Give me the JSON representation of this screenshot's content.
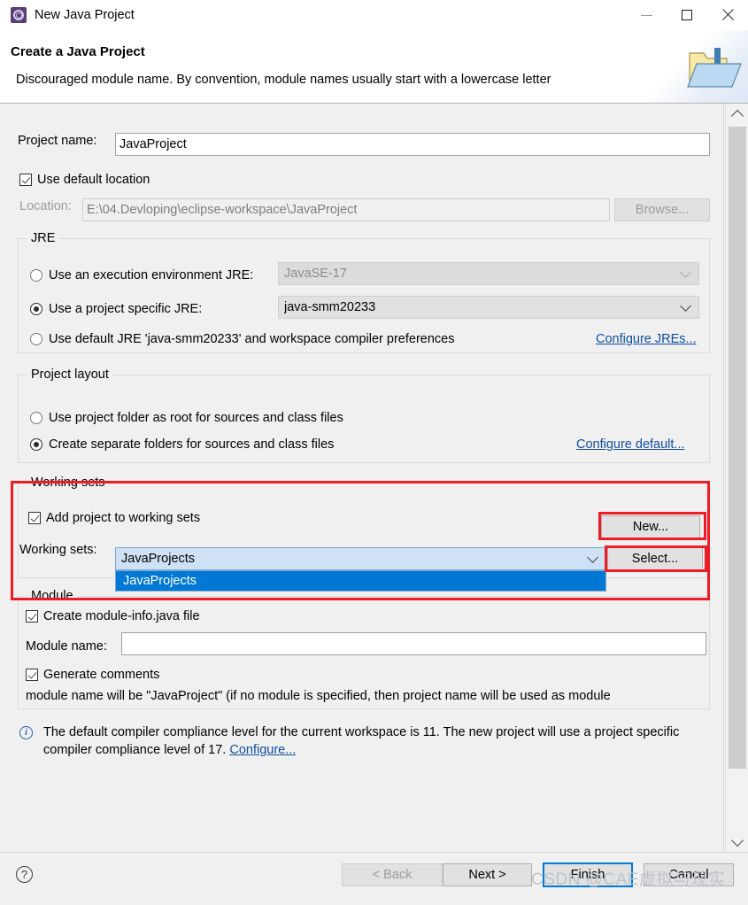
{
  "window": {
    "title": "New Java Project",
    "icon": "eclipse-gear-icon",
    "minimize_label": "–",
    "maximize_label": "□",
    "close_label": "✕"
  },
  "header": {
    "title": "Create a Java Project",
    "description": "Discouraged module name. By convention, module names usually start with a lowercase letter",
    "art_icon": "new-java-project-folder-icon"
  },
  "project": {
    "name_label": "Project name:",
    "name_value": "JavaProject",
    "use_default_location_label": "Use default location",
    "use_default_location_checked": true,
    "location_label": "Location:",
    "location_value": "E:\\04.Devloping\\eclipse-workspace\\JavaProject",
    "browse_label": "Browse..."
  },
  "jre": {
    "group_title": "JRE",
    "exec_env_label": "Use an execution environment JRE:",
    "exec_env_selected": false,
    "exec_env_value": "JavaSE-17",
    "project_specific_label": "Use a project specific JRE:",
    "project_specific_selected": true,
    "project_specific_value": "java-smm20233",
    "default_jre_label": "Use default JRE 'java-smm20233' and workspace compiler preferences",
    "default_jre_selected": false,
    "configure_link": "Configure JREs..."
  },
  "layout": {
    "group_title": "Project layout",
    "use_project_folder_label": "Use project folder as root for sources and class files",
    "use_project_folder_selected": false,
    "separate_folders_label": "Create separate folders for sources and class files",
    "separate_folders_selected": true,
    "configure_link": "Configure default..."
  },
  "working_sets": {
    "group_title": "Working sets",
    "add_project_label": "Add project to working sets",
    "add_project_checked": true,
    "new_button": "New...",
    "working_sets_label": "Working sets:",
    "selected_value": "JavaProjects",
    "select_button": "Select...",
    "dropdown_open": true,
    "dropdown_options": [
      "JavaProjects"
    ]
  },
  "module": {
    "group_title": "Module",
    "create_module_info_label": "Create module-info.java file",
    "create_module_info_checked": true,
    "module_name_label": "Module name:",
    "module_name_value": "",
    "generate_comments_label": "Generate comments",
    "generate_comments_checked": true,
    "note": "module name will be \"JavaProject\"  (if no module is specified, then project name will be used as module"
  },
  "info": {
    "icon": "info-icon",
    "text_line1": "The default compiler compliance level for the current workspace is 11. The new project will use a",
    "text_line2": "project specific compiler compliance level of 17. ",
    "configure_link": "Configure..."
  },
  "footer": {
    "help_label": "?",
    "back_label": "< Back",
    "back_disabled": true,
    "next_label": "Next >",
    "finish_label": "Finish",
    "finish_is_default": true,
    "cancel_label": "Cancel",
    "watermark": "CSDN @CAE虚拟与现实"
  },
  "colors": {
    "accent_blue": "#0078d4",
    "link_blue": "#0f4f9e",
    "annotation_red": "#ee1c25",
    "dialog_bg": "#f0f0f0",
    "combo_highlight": "#cfe1f5"
  },
  "scrollbar": {
    "up_arrow": "chevron-up-icon",
    "down_arrow": "chevron-down-icon"
  }
}
